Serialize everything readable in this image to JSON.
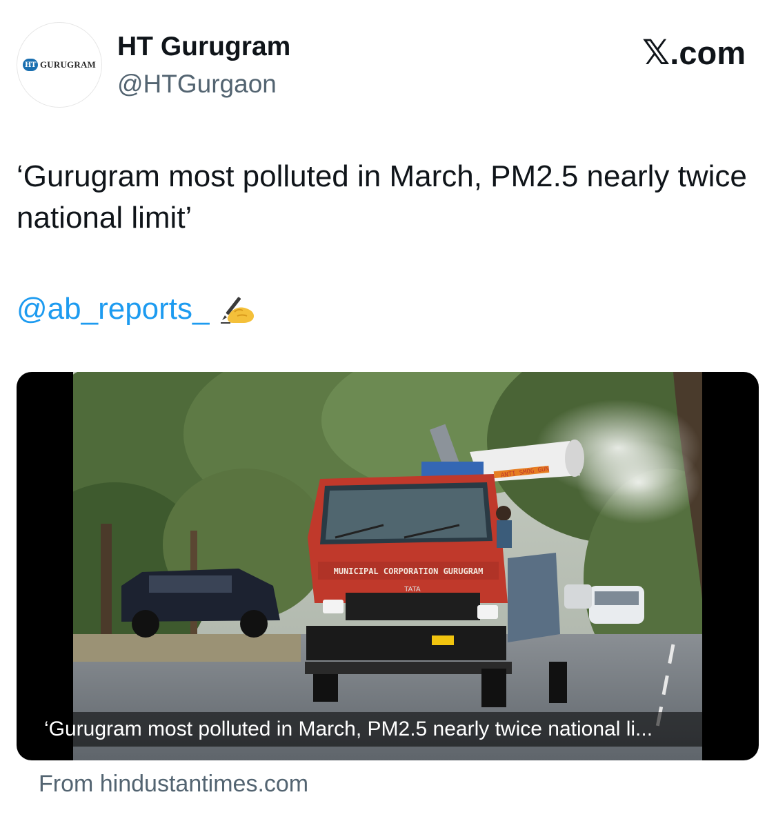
{
  "account": {
    "avatar_logo_mark": "HT",
    "avatar_logo_text": "GURUGRAM",
    "display_name": "HT Gurugram",
    "handle": "@HTGurgaon"
  },
  "brand": {
    "x_glyph": "𝕏",
    "domain_suffix": ".com"
  },
  "tweet": {
    "text": "‘Gurugram most polluted in March, PM2.5 nearly twice national limit’",
    "mention": "@ab_reports_",
    "emoji_icon": "writing-hand-icon"
  },
  "card": {
    "image_alt": "Municipal Corporation Gurugram anti-smog gun truck spraying water mist on a tree-lined road",
    "truck_label": "MUNICIPAL CORPORATION GURUGRAM",
    "truck_make": "TATA",
    "smog_gun_label": "ANTI SMOG GUN",
    "caption": "‘Gurugram most polluted in March, PM2.5 nearly twice national li...",
    "source": "From hindustantimes.com"
  },
  "colors": {
    "link": "#1d9bf0",
    "secondary_text": "#536471",
    "primary_text": "#0f1419",
    "truck_red": "#c0392b"
  }
}
